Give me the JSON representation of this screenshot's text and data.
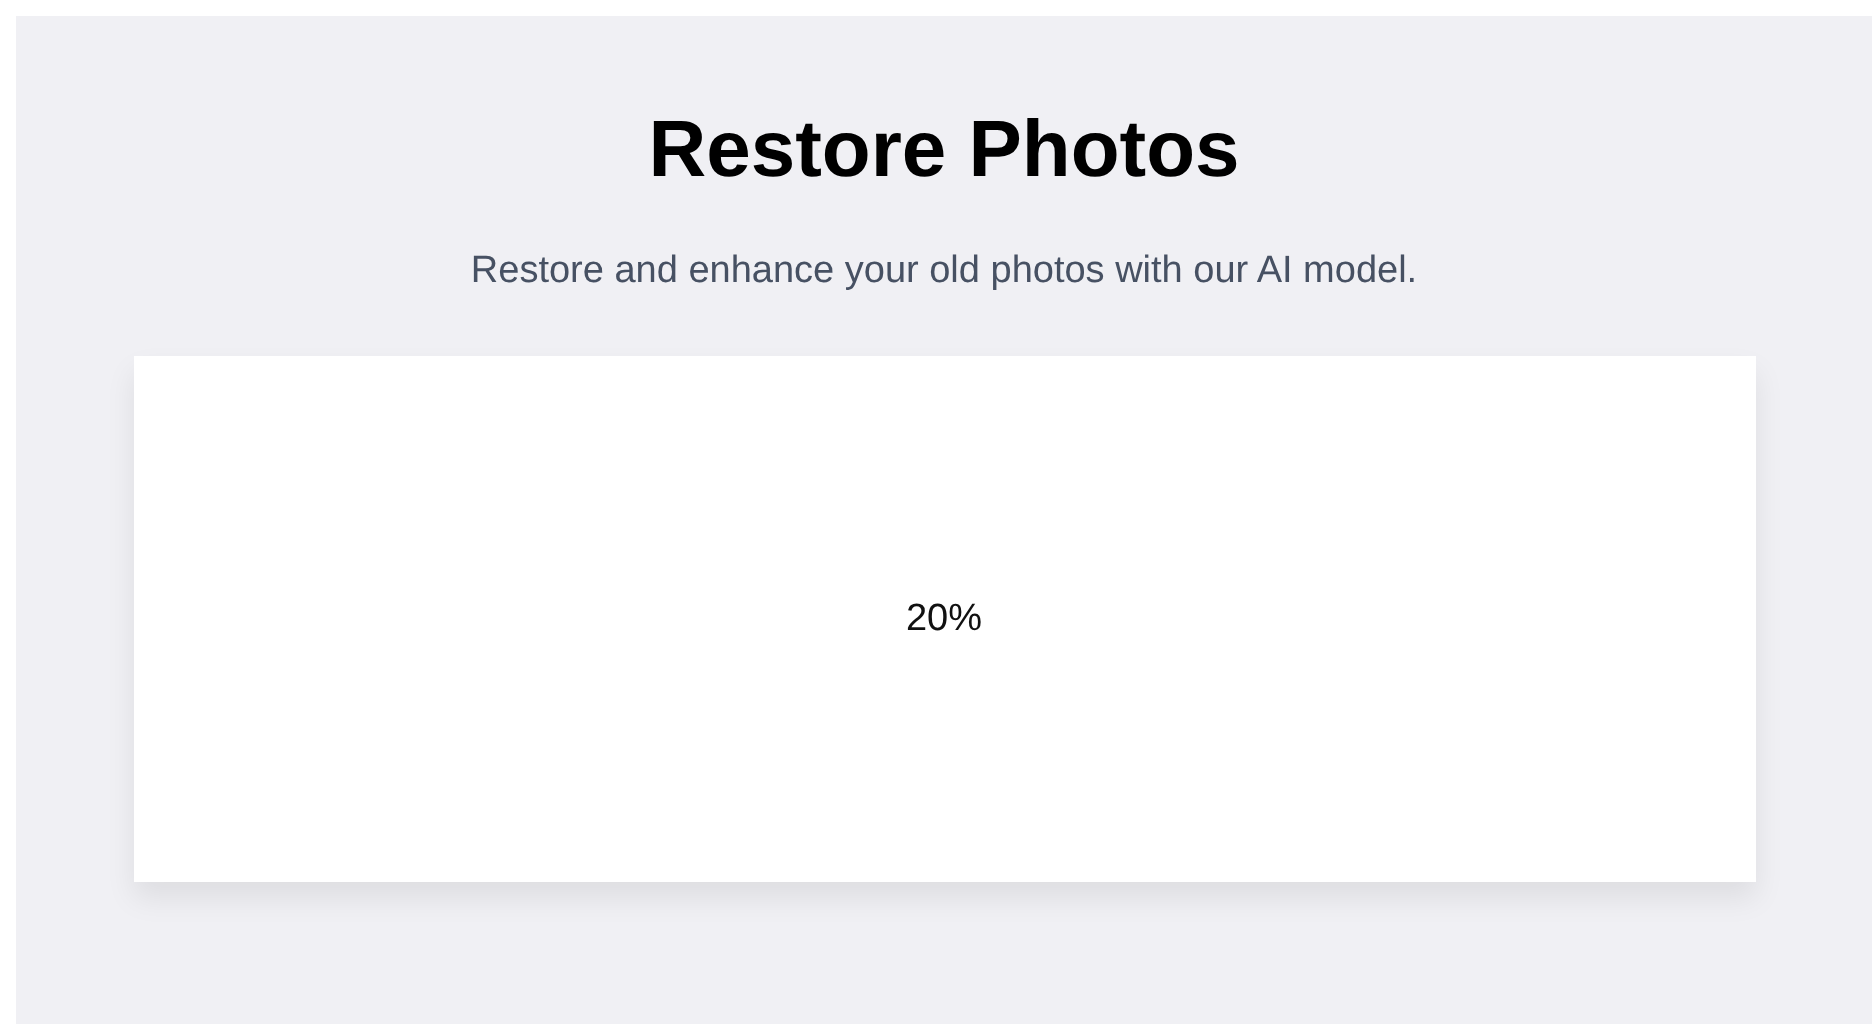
{
  "header": {
    "title": "Restore Photos",
    "subtitle": "Restore and enhance your old photos with our AI model."
  },
  "upload_card": {
    "progress_text": "20%"
  }
}
